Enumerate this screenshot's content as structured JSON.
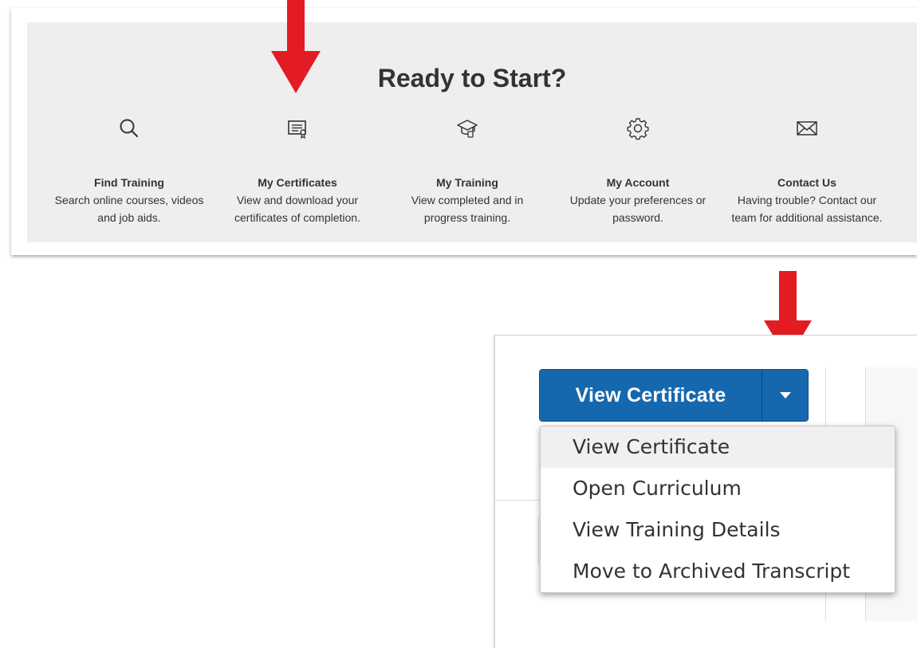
{
  "panel": {
    "title": "Ready to Start?",
    "features": [
      {
        "icon": "search-icon",
        "name": "Find Training",
        "desc_line1": "Search online courses, videos",
        "desc_line2": "and job aids."
      },
      {
        "icon": "certificate-icon",
        "name": "My Certificates",
        "desc_line1": "View and download your",
        "desc_line2": "certificates of completion."
      },
      {
        "icon": "graduation-cap-icon",
        "name": "My Training",
        "desc_line1": "View completed and in",
        "desc_line2": "progress training."
      },
      {
        "icon": "gear-icon",
        "name": "My Account",
        "desc_line1": "Update your preferences or",
        "desc_line2": "password."
      },
      {
        "icon": "envelope-icon",
        "name": "Contact Us",
        "desc_line1": "Having trouble? Contact our",
        "desc_line2": "team for additional assistance."
      }
    ]
  },
  "action": {
    "button_label": "View Certificate",
    "toggle_icon": "caret-down-icon",
    "menu_items": [
      "View Certificate",
      "Open Curriculum",
      "View Training Details",
      "Move to Archived Transcript"
    ]
  },
  "colors": {
    "panel_bg": "#eeeeee",
    "button_blue": "#1568ad",
    "arrow_red": "#e31b23",
    "text": "#333333"
  }
}
